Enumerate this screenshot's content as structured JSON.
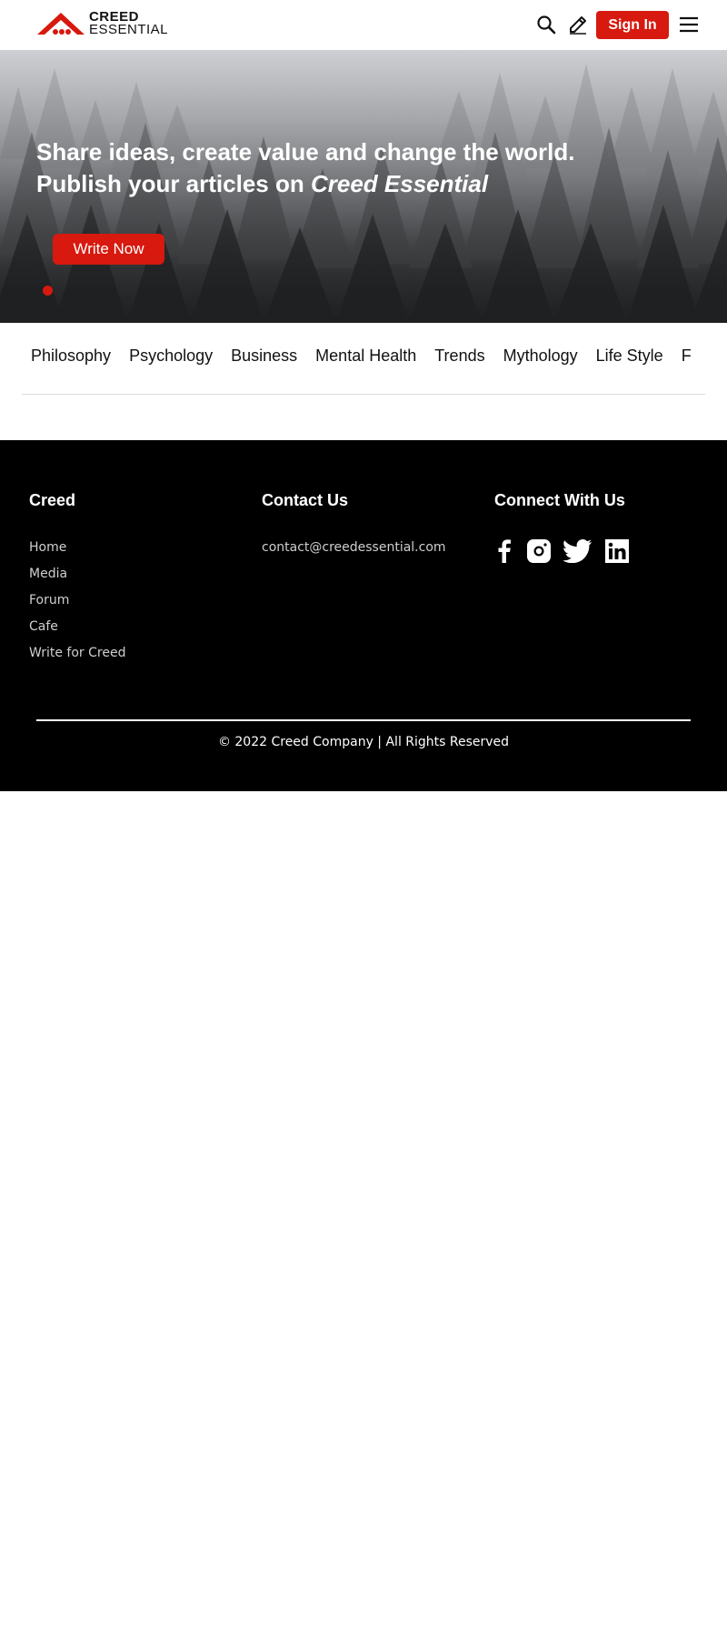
{
  "header": {
    "logo": {
      "line1": "CREED",
      "line2": "ESSENTIAL"
    },
    "search_icon": "search-icon",
    "write_icon": "pencil-icon",
    "signin_label": "Sign In",
    "menu_icon": "hamburger-menu-icon"
  },
  "hero": {
    "line1": "Share ideas, create value and change the world.",
    "line2_prefix": "Publish your articles on ",
    "line2_brand": "Creed Essential",
    "cta_label": "Write Now",
    "slide_count": 1,
    "active_slide": 1
  },
  "categories": [
    "Philosophy",
    "Psychology",
    "Business",
    "Mental Health",
    "Trends",
    "Mythology",
    "Life Style",
    "F"
  ],
  "footer": {
    "col1": {
      "title": "Creed",
      "links": [
        "Home",
        "Media",
        "Forum",
        "Cafe",
        "Write for Creed"
      ]
    },
    "col2": {
      "title": "Contact Us",
      "email": "contact@creedessential.com"
    },
    "col3": {
      "title": "Connect With Us",
      "icons": [
        "facebook-icon",
        "instagram-icon",
        "twitter-icon",
        "linkedin-icon"
      ]
    },
    "copyright": "© 2022 Creed Company | All Rights Reserved"
  },
  "colors": {
    "accent": "#d7190f",
    "footer_bg": "#000000",
    "text": "#111111"
  }
}
